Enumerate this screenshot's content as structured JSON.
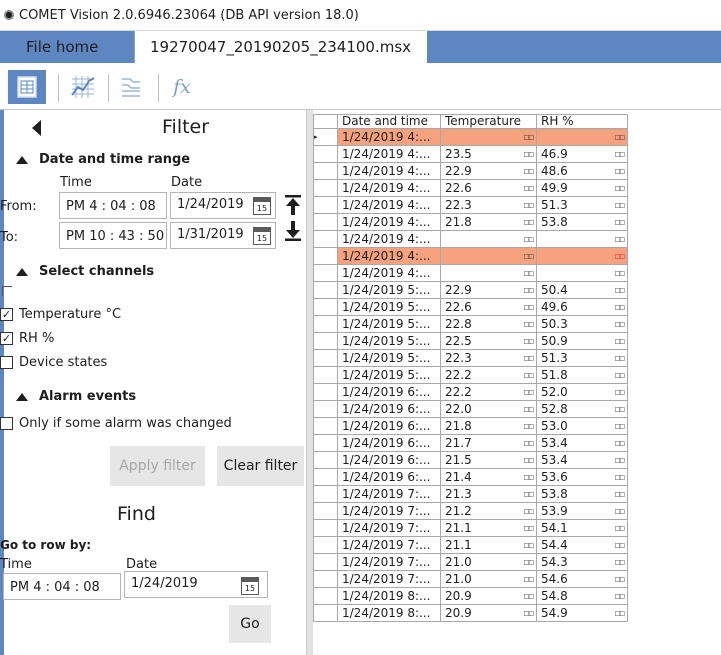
{
  "window": {
    "title": "COMET Vision 2.0.6946.23064 (DB API version 18.0)"
  },
  "tabs": {
    "home": "File home",
    "file": "19270047_20190205_234100.msx"
  },
  "toolbar": {
    "icons": [
      "table-view-icon",
      "chart-grid-icon",
      "channel-lines-icon",
      "function-icon"
    ],
    "fx": "fx"
  },
  "filter": {
    "title": "Filter",
    "date_range": {
      "heading": "Date and time range",
      "time_label": "Time",
      "date_label": "Date",
      "from_label": "From:",
      "to_label": "To:",
      "from_time": "PM 4 : 04 : 08",
      "from_date": "1/24/2019",
      "to_time": "PM 10 : 43 : 50",
      "to_date": "1/31/2019",
      "cal_day": "15"
    },
    "channels": {
      "heading": "Select channels",
      "items": [
        {
          "label": "Temperature °C",
          "checked": true
        },
        {
          "label": "RH %",
          "checked": true
        },
        {
          "label": "Device states",
          "checked": false
        }
      ]
    },
    "alarms": {
      "heading": "Alarm events",
      "only_changed": "Only if some alarm was changed"
    },
    "apply_label": "Apply filter",
    "clear_label": "Clear filter"
  },
  "find": {
    "title": "Find",
    "goto_label": "Go to row by:",
    "time_label": "Time",
    "date_label": "Date",
    "time_value": "PM 4 : 04 : 08",
    "date_value": "1/24/2019",
    "cal_day": "15",
    "go_label": "Go"
  },
  "grid": {
    "columns": [
      "Date and time",
      "Temperature",
      "RH %"
    ],
    "flag": "□□",
    "rows": [
      {
        "date": "1/24/2019 4:...",
        "temp": "",
        "rh": "",
        "highlight": true,
        "current": true
      },
      {
        "date": "1/24/2019 4:...",
        "temp": "23.5",
        "rh": "46.9"
      },
      {
        "date": "1/24/2019 4:...",
        "temp": "22.9",
        "rh": "48.6"
      },
      {
        "date": "1/24/2019 4:...",
        "temp": "22.6",
        "rh": "49.9"
      },
      {
        "date": "1/24/2019 4:...",
        "temp": "22.3",
        "rh": "51.3"
      },
      {
        "date": "1/24/2019 4:...",
        "temp": "21.8",
        "rh": "53.8"
      },
      {
        "date": "1/24/2019 4:...",
        "temp": "",
        "rh": ""
      },
      {
        "date": "1/24/2019 4:...",
        "temp": "",
        "rh": "",
        "highlight": true,
        "alarm": true
      },
      {
        "date": "1/24/2019 4:...",
        "temp": "",
        "rh": ""
      },
      {
        "date": "1/24/2019 5:...",
        "temp": "22.9",
        "rh": "50.4"
      },
      {
        "date": "1/24/2019 5:...",
        "temp": "22.6",
        "rh": "49.6"
      },
      {
        "date": "1/24/2019 5:...",
        "temp": "22.8",
        "rh": "50.3"
      },
      {
        "date": "1/24/2019 5:...",
        "temp": "22.5",
        "rh": "50.9"
      },
      {
        "date": "1/24/2019 5:...",
        "temp": "22.3",
        "rh": "51.3"
      },
      {
        "date": "1/24/2019 5:...",
        "temp": "22.2",
        "rh": "51.8"
      },
      {
        "date": "1/24/2019 6:...",
        "temp": "22.2",
        "rh": "52.0"
      },
      {
        "date": "1/24/2019 6:...",
        "temp": "22.0",
        "rh": "52.8"
      },
      {
        "date": "1/24/2019 6:...",
        "temp": "21.8",
        "rh": "53.0"
      },
      {
        "date": "1/24/2019 6:...",
        "temp": "21.7",
        "rh": "53.4"
      },
      {
        "date": "1/24/2019 6:...",
        "temp": "21.5",
        "rh": "53.4"
      },
      {
        "date": "1/24/2019 6:...",
        "temp": "21.4",
        "rh": "53.6"
      },
      {
        "date": "1/24/2019 7:...",
        "temp": "21.3",
        "rh": "53.8"
      },
      {
        "date": "1/24/2019 7:...",
        "temp": "21.2",
        "rh": "53.9"
      },
      {
        "date": "1/24/2019 7:...",
        "temp": "21.1",
        "rh": "54.1"
      },
      {
        "date": "1/24/2019 7:...",
        "temp": "21.1",
        "rh": "54.4"
      },
      {
        "date": "1/24/2019 7:...",
        "temp": "21.0",
        "rh": "54.3"
      },
      {
        "date": "1/24/2019 7:...",
        "temp": "21.0",
        "rh": "54.6"
      },
      {
        "date": "1/24/2019 8:...",
        "temp": "20.9",
        "rh": "54.8"
      },
      {
        "date": "1/24/2019 8:...",
        "temp": "20.9",
        "rh": "54.9"
      }
    ]
  }
}
